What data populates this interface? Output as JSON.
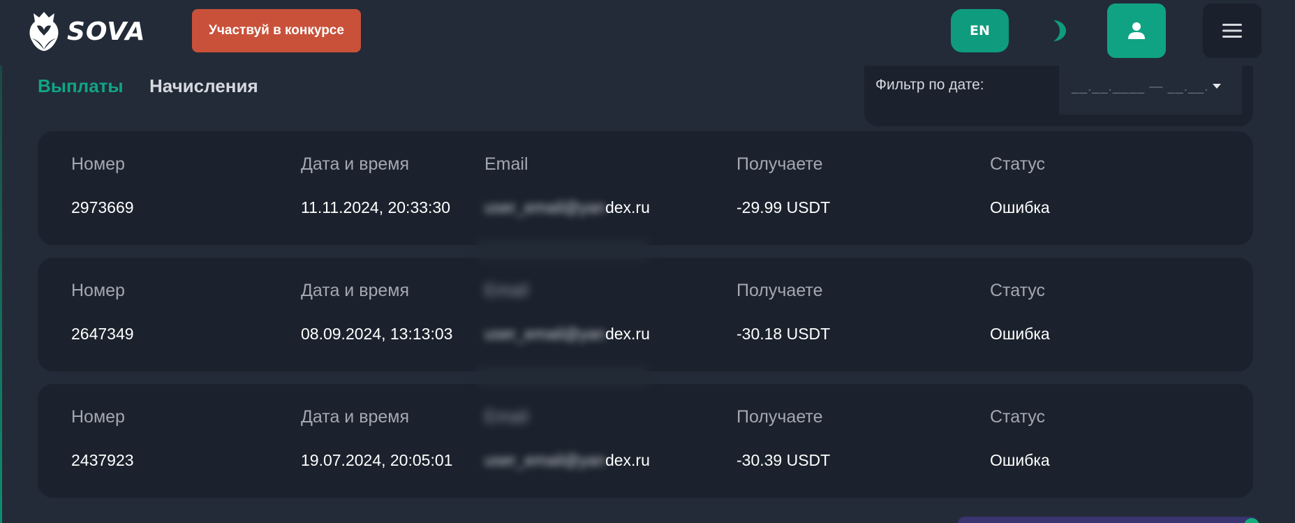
{
  "header": {
    "logo_text": "SOVA",
    "contest_button": "Участвуй в конкурсе",
    "language_button": "EN"
  },
  "tabs": [
    {
      "label": "Выплаты",
      "active": true
    },
    {
      "label": "Начисления",
      "active": false
    }
  ],
  "filter": {
    "label": "Фильтр по дате:",
    "placeholder": "__.__.____ — __.__."
  },
  "columns": {
    "number": "Номер",
    "datetime": "Дата и время",
    "email": "Email",
    "receive": "Получаете",
    "status": "Статус"
  },
  "payouts": [
    {
      "number": "2973669",
      "datetime": "11.11.2024, 20:33:30",
      "email_masked": "user_email@yan",
      "email_visible": "dex.ru",
      "receive": "-29.99 USDT",
      "status": "Ошибка"
    },
    {
      "number": "2647349",
      "datetime": "08.09.2024, 13:13:03",
      "email_masked": "user_email@yan",
      "email_visible": "dex.ru",
      "receive": "-30.18 USDT",
      "status": "Ошибка"
    },
    {
      "number": "2437923",
      "datetime": "19.07.2024, 20:05:01",
      "email_masked": "user_email@yan",
      "email_visible": "dex.ru",
      "receive": "-30.39 USDT",
      "status": "Ошибка"
    }
  ],
  "colors": {
    "accent": "#11a585",
    "contest": "#c9513a",
    "background": "#232b38",
    "card": "#1b222d"
  }
}
